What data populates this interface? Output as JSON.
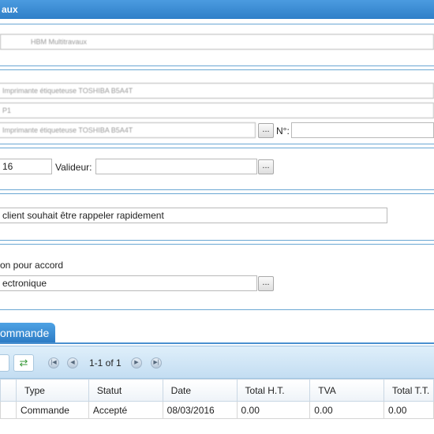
{
  "header": {
    "title": "aux"
  },
  "fields": {
    "client_name": "HBM Multitravaux",
    "designation": "Imprimante étiqueteuse TOSHIBA B5A4T",
    "reference": "P1",
    "article": "Imprimante étiqueteuse TOSHIBA B5A4T",
    "number_label": "N°:",
    "number_value": "",
    "date_value": "16",
    "validator_label": "Valideur:",
    "validator_value": "",
    "comment": "client souhait être rappeler rapidement",
    "status_text": "on pour accord",
    "channel": "ectronique"
  },
  "buttons": {
    "ellipsis": "..."
  },
  "tab": {
    "label": "ommande"
  },
  "toolbar": {
    "pagination": "1-1 of 1"
  },
  "grid": {
    "columns": [
      "",
      "Type",
      "Statut",
      "Date",
      "Total H.T.",
      "TVA",
      "Total T.T."
    ],
    "rows": [
      [
        "",
        "Commande",
        "Accepté",
        "08/03/2016",
        "0.00",
        "0.00",
        "0.00"
      ]
    ]
  }
}
